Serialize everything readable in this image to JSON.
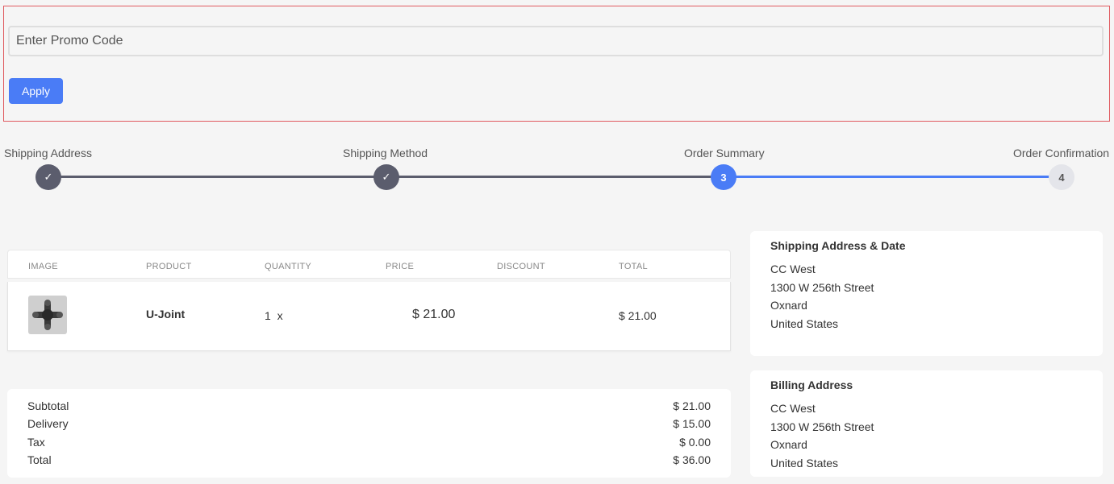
{
  "promo": {
    "placeholder": "Enter Promo Code",
    "apply_label": "Apply"
  },
  "stepper": {
    "steps": [
      {
        "label": "Shipping Address",
        "state": "done",
        "marker": "✓"
      },
      {
        "label": "Shipping Method",
        "state": "done",
        "marker": "✓"
      },
      {
        "label": "Order Summary",
        "state": "active",
        "marker": "3"
      },
      {
        "label": "Order Confirmation",
        "state": "pending",
        "marker": "4"
      }
    ],
    "colors": {
      "done": "#5b5d6d",
      "active": "#4a7cf6",
      "pending": "#e4e5ea"
    }
  },
  "cart": {
    "columns": [
      "IMAGE",
      "PRODUCT",
      "QUANTITY",
      "PRICE",
      "DISCOUNT",
      "TOTAL"
    ],
    "items": [
      {
        "image_icon": "u-joint-image",
        "product": "U-Joint",
        "quantity": "1",
        "qty_suffix": "x",
        "price": "$ 21.00",
        "discount": "",
        "total": "$ 21.00"
      }
    ]
  },
  "totals": {
    "subtotal_label": "Subtotal",
    "subtotal": "$ 21.00",
    "delivery_label": "Delivery",
    "delivery": "$ 15.00",
    "tax_label": "Tax",
    "tax": "$ 0.00",
    "total_label": "Total",
    "total": "$ 36.00"
  },
  "shipping": {
    "title": "Shipping Address & Date",
    "name": "CC West",
    "street": "1300 W 256th Street",
    "city": "Oxnard",
    "country": "United States"
  },
  "billing": {
    "title": "Billing Address",
    "name": "CC West",
    "street": "1300 W 256th Street",
    "city": "Oxnard",
    "country": "United States"
  }
}
